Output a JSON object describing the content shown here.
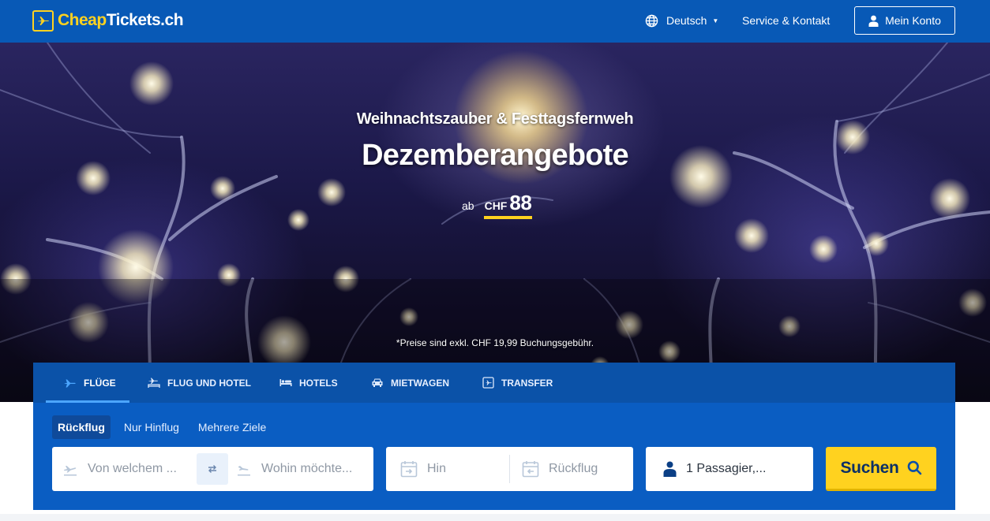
{
  "header": {
    "logo": {
      "part1": "Cheap",
      "part2": "Tickets.ch"
    },
    "language": {
      "label": "Deutsch",
      "icon": "globe-icon"
    },
    "service_label": "Service & Kontakt",
    "account": {
      "label": "Mein Konto",
      "icon": "user-icon"
    }
  },
  "hero": {
    "subtitle": "Weihnachtszauber & Festtagsfernweh",
    "title": "Dezemberangebote",
    "price_prefix": "ab",
    "price_currency": "CHF",
    "price_value": "88",
    "disclaimer": "*Preise sind exkl. CHF 19,99 Buchungsgebühr."
  },
  "search": {
    "tabs": [
      {
        "label": "FLÜGE",
        "icon": "plane-icon",
        "active": true
      },
      {
        "label": "FLUG UND HOTEL",
        "icon": "plane-hotel-icon",
        "active": false
      },
      {
        "label": "HOTELS",
        "icon": "bed-icon",
        "active": false
      },
      {
        "label": "MIETWAGEN",
        "icon": "car-icon",
        "active": false
      },
      {
        "label": "TRANSFER",
        "icon": "transfer-icon",
        "active": false
      }
    ],
    "trip_types": [
      {
        "label": "Rückflug",
        "active": true
      },
      {
        "label": "Nur Hinflug",
        "active": false
      },
      {
        "label": "Mehrere Ziele",
        "active": false
      }
    ],
    "from_placeholder": "Von welchem ...",
    "to_placeholder": "Wohin möchte...",
    "depart_placeholder": "Hin",
    "return_placeholder": "Rückflug",
    "passengers": "1 Passagier,...",
    "search_label": "Suchen"
  },
  "colors": {
    "brand_blue": "#0859b6",
    "accent_yellow": "#ffd21f",
    "panel_blue": "#0a5dc2"
  }
}
